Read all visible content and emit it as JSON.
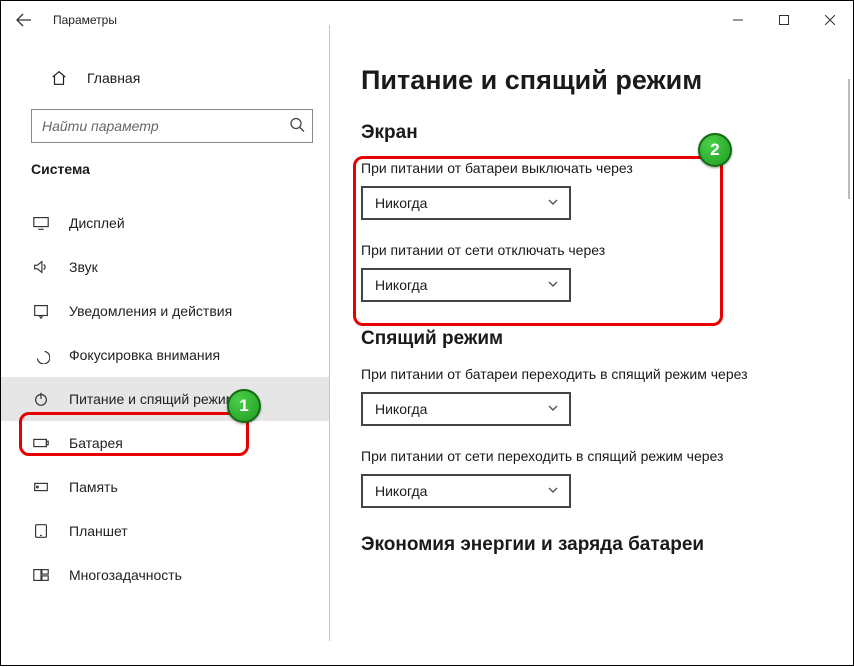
{
  "window": {
    "title": "Параметры"
  },
  "sidebar": {
    "home": "Главная",
    "search_placeholder": "Найти параметр",
    "category": "Система",
    "items": [
      {
        "label": "Дисплей"
      },
      {
        "label": "Звук"
      },
      {
        "label": "Уведомления и действия"
      },
      {
        "label": "Фокусировка внимания"
      },
      {
        "label": "Питание и спящий режим"
      },
      {
        "label": "Батарея"
      },
      {
        "label": "Память"
      },
      {
        "label": "Планшет"
      },
      {
        "label": "Многозадачность"
      }
    ]
  },
  "main": {
    "title": "Питание и спящий режим",
    "screen": {
      "heading": "Экран",
      "battery_label": "При питании от батареи выключать через",
      "battery_value": "Никогда",
      "plugged_label": "При питании от сети отключать через",
      "plugged_value": "Никогда"
    },
    "sleep": {
      "heading": "Спящий режим",
      "battery_label": "При питании от батареи переходить в спящий режим через",
      "battery_value": "Никогда",
      "plugged_label": "При питании от сети переходить в спящий режим через",
      "plugged_value": "Никогда"
    },
    "battery_section": {
      "heading": "Экономия энергии и заряда батареи"
    }
  },
  "annotations": {
    "badge1": "1",
    "badge2": "2"
  }
}
